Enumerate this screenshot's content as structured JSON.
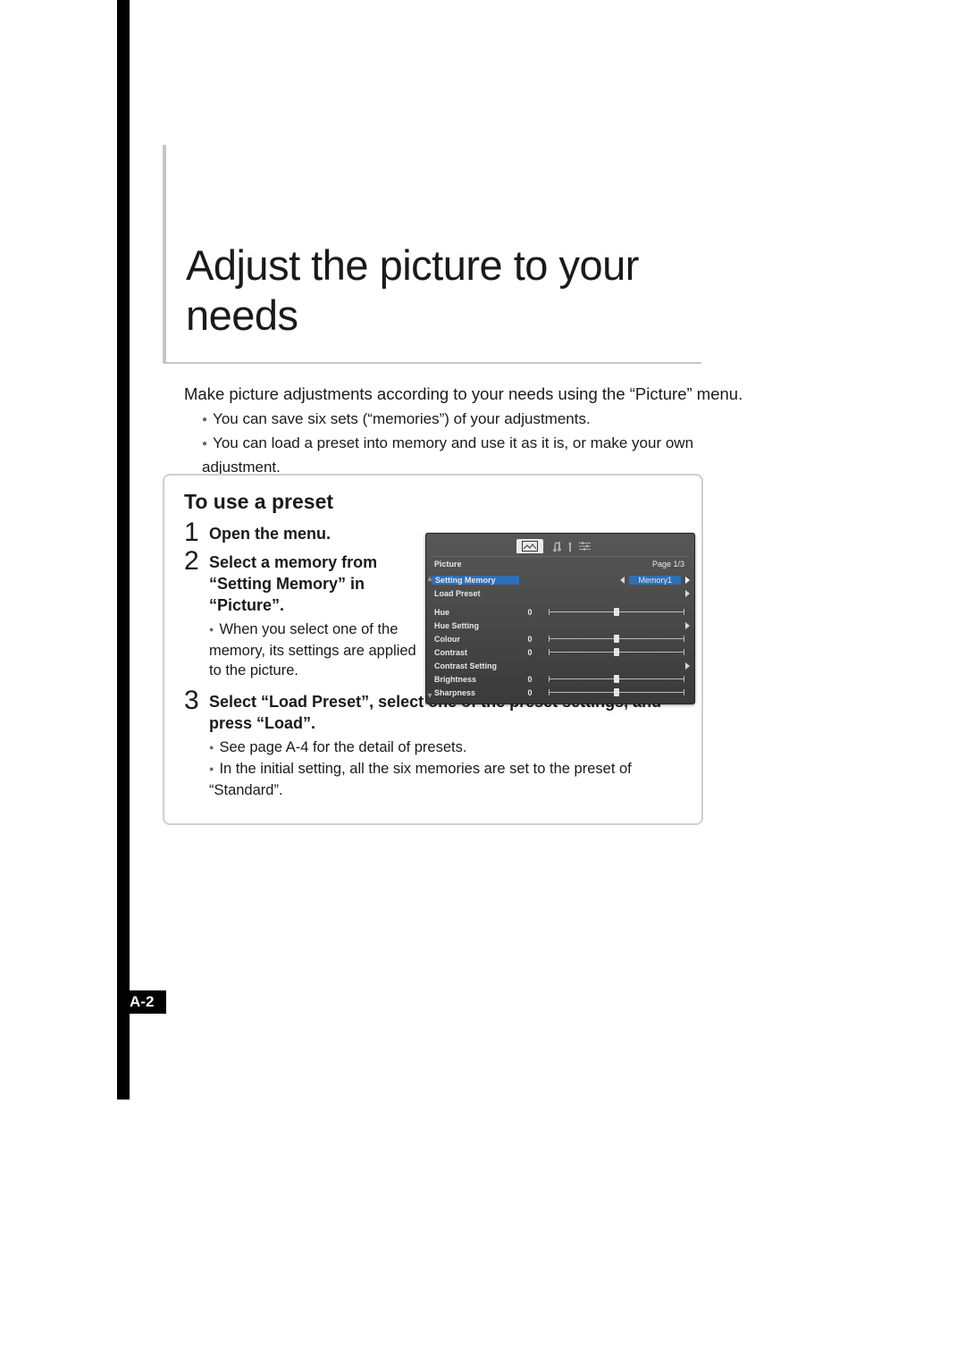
{
  "title": "Adjust the picture to your needs",
  "intro": {
    "lead": "Make picture adjustments according to your needs using the “Picture” menu.",
    "bullets": [
      "You can save six sets (“memories”) of your adjustments.",
      "You can load a preset into memory and use it as it is, or make your own adjustment."
    ]
  },
  "card": {
    "title": "To use a preset",
    "steps": [
      {
        "num": "1",
        "head": "Open the menu."
      },
      {
        "num": "2",
        "head": "Select a memory from “Setting Memory” in “Picture”.",
        "sub": [
          "When you select one of the memory, its settings are applied to the picture."
        ]
      },
      {
        "num": "3",
        "head": "Select “Load Preset”, select one of the preset settings, and press “Load”.",
        "sub": [
          "See page A-4 for the detail of presets.",
          "In the initial setting, all the six memories are set to the preset of “Standard”."
        ]
      }
    ]
  },
  "osd": {
    "tab_active": "Picture",
    "page": "Page 1/3",
    "rows": [
      {
        "label": "Setting Memory",
        "type": "select",
        "value": "Memory1"
      },
      {
        "label": "Load Preset",
        "type": "link"
      },
      {
        "label": "",
        "type": "spacer"
      },
      {
        "label": "Hue",
        "type": "slider",
        "value": "0"
      },
      {
        "label": "Hue Setting",
        "type": "link"
      },
      {
        "label": "Colour",
        "type": "slider",
        "value": "0"
      },
      {
        "label": "Contrast",
        "type": "slider",
        "value": "0"
      },
      {
        "label": "Contrast Setting",
        "type": "link"
      },
      {
        "label": "Brightness",
        "type": "slider",
        "value": "0"
      },
      {
        "label": "Sharpness",
        "type": "slider",
        "value": "0"
      }
    ]
  },
  "page_number": "A-2"
}
